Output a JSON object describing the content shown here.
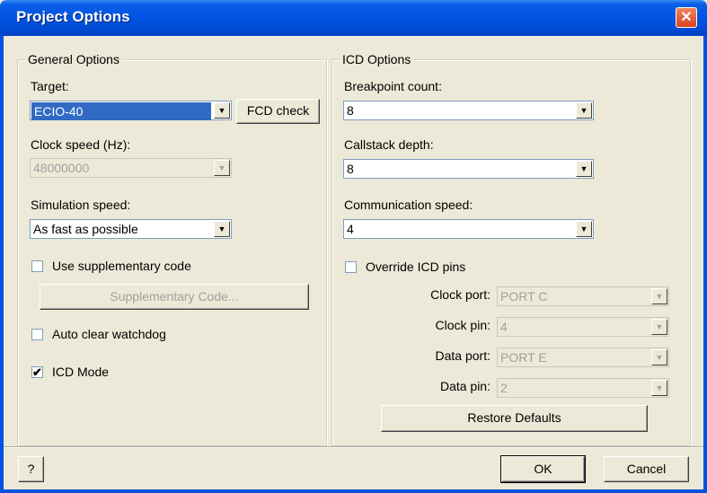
{
  "window": {
    "title": "Project Options",
    "close_glyph": "✕"
  },
  "general": {
    "legend": "General Options",
    "target_label": "Target:",
    "target_value": "ECIO-40",
    "fcd_check": "FCD check",
    "clock_label": "Clock speed (Hz):",
    "clock_value": "48000000",
    "sim_label": "Simulation speed:",
    "sim_value": "As fast as possible",
    "use_supp_label": "Use supplementary code",
    "use_supp_checked": false,
    "supp_button": "Supplementary Code...",
    "auto_clear_label": "Auto clear watchdog",
    "auto_clear_checked": false,
    "icd_mode_label": "ICD Mode",
    "icd_mode_checked": true
  },
  "icd": {
    "legend": "ICD Options",
    "bp_label": "Breakpoint count:",
    "bp_value": "8",
    "cs_label": "Callstack depth:",
    "cs_value": "8",
    "comm_label": "Communication speed:",
    "comm_value": "4",
    "override_label": "Override ICD pins",
    "override_checked": false,
    "clock_port_label": "Clock port:",
    "clock_port_value": "PORT C",
    "clock_pin_label": "Clock pin:",
    "clock_pin_value": "4",
    "data_port_label": "Data port:",
    "data_port_value": "PORT E",
    "data_pin_label": "Data pin:",
    "data_pin_value": "2",
    "restore_button": "Restore Defaults"
  },
  "footer": {
    "help": "?",
    "ok": "OK",
    "cancel": "Cancel"
  },
  "icons": {
    "dropdown": "▼",
    "check": "✔"
  },
  "colors": {
    "titlebar": "#0055e5",
    "selection": "#316ac5",
    "face": "#ece9d8"
  }
}
